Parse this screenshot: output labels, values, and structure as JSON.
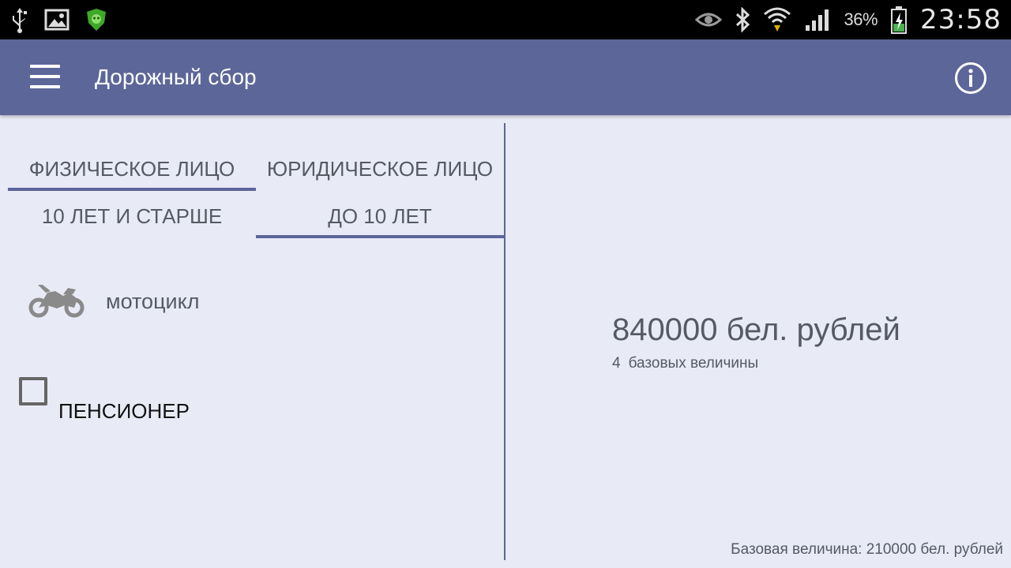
{
  "status_bar": {
    "icons_left": [
      "usb-icon",
      "gallery-icon",
      "antivirus-icon"
    ],
    "icons_right": [
      "eye-icon",
      "bluetooth-icon",
      "wifi-icon",
      "signal-icon",
      "battery-icon"
    ],
    "battery_percent": "36%",
    "time": "23:58"
  },
  "app_bar": {
    "title": "Дорожный сбор",
    "color": "#5c6699"
  },
  "owner_tabs": [
    {
      "label": "ФИЗИЧЕСКОЕ ЛИЦО",
      "selected": true
    },
    {
      "label": "ЮРИДИЧЕСКОЕ ЛИЦО",
      "selected": false
    }
  ],
  "age_tabs": [
    {
      "label": "10 ЛЕТ И СТАРШЕ",
      "selected": false
    },
    {
      "label": "ДО 10 ЛЕТ",
      "selected": true
    }
  ],
  "vehicle": {
    "icon": "motorcycle-icon",
    "label": "мотоцикл"
  },
  "pensioner": {
    "label": "ПЕНСИОНЕР",
    "checked": false
  },
  "result": {
    "amount": "840000 бел. рублей",
    "base_units": "4",
    "base_units_label": "базовых величины"
  },
  "footer": {
    "base_value_note": "Базовая величина: 210000 бел. рублей"
  }
}
